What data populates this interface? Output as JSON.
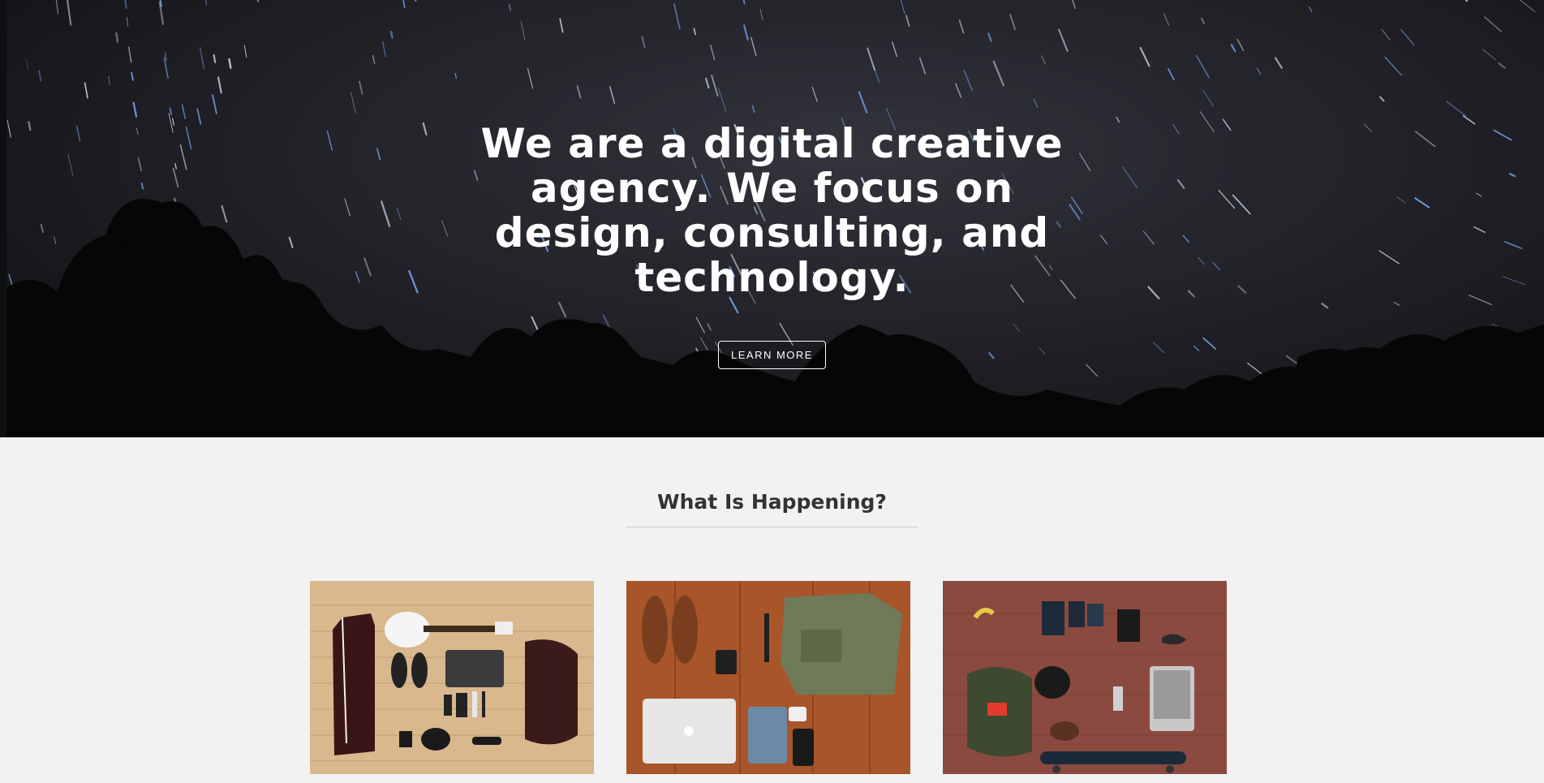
{
  "hero": {
    "headline": "We are a digital creative agency. We focus on design, consulting, and technology.",
    "cta_label": "LEARN MORE"
  },
  "section": {
    "title": "What Is Happening?"
  },
  "cards": [
    {
      "image": "guitar-flatlay-photo"
    },
    {
      "image": "shoes-bag-laptop-flatlay-photo"
    },
    {
      "image": "skateboard-backpack-flatlay-photo"
    }
  ],
  "colors": {
    "hero_bg": "#1d1d22",
    "page_bg": "#f2f2f2",
    "heading": "#333333",
    "white": "#ffffff"
  }
}
